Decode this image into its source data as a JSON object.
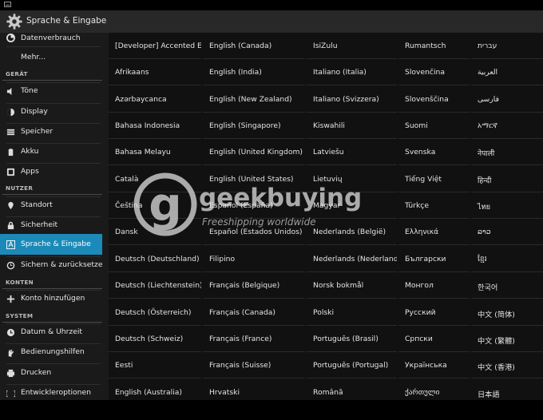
{
  "app": {
    "title": "Sprache & Eingabe"
  },
  "sidebar": {
    "items": [
      {
        "label": "Datenverbrauch",
        "icon": "data-usage-icon"
      },
      {
        "label": "Mehr...",
        "icon": ""
      },
      {
        "header": "GERÄT"
      },
      {
        "label": "Töne",
        "icon": "volume-icon"
      },
      {
        "label": "Display",
        "icon": "brightness-icon"
      },
      {
        "label": "Speicher",
        "icon": "storage-icon"
      },
      {
        "label": "Akku",
        "icon": "battery-icon"
      },
      {
        "label": "Apps",
        "icon": "apps-icon"
      },
      {
        "header": "NUTZER"
      },
      {
        "label": "Standort",
        "icon": "location-pin-icon"
      },
      {
        "label": "Sicherheit",
        "icon": "lock-icon"
      },
      {
        "label": "Sprache & Eingabe",
        "icon": "keyboard-a-icon",
        "selected": true
      },
      {
        "label": "Sichern & zurücksetzen",
        "icon": "backup-icon"
      },
      {
        "header": "KONTEN"
      },
      {
        "label": "Konto hinzufügen",
        "icon": "plus-icon"
      },
      {
        "header": "SYSTEM"
      },
      {
        "label": "Datum & Uhrzeit",
        "icon": "clock-icon"
      },
      {
        "label": "Bedienungshilfen",
        "icon": "hand-icon"
      },
      {
        "label": "Drucken",
        "icon": "printer-icon"
      },
      {
        "label": "Entwickleroptionen",
        "icon": "braces-icon"
      }
    ]
  },
  "languages": {
    "columns": [
      [
        "[Developer] Accented English",
        "Afrikaans",
        "Azərbaycanca",
        "Bahasa Indonesia",
        "Bahasa Melayu",
        "Català",
        "Čeština",
        "Dansk",
        "Deutsch (Deutschland)",
        "Deutsch (Liechtenstein)",
        "Deutsch (Österreich)",
        "Deutsch (Schweiz)",
        "Eesti",
        "English (Australia)"
      ],
      [
        "English (Canada)",
        "English (India)",
        "English (New Zealand)",
        "English (Singapore)",
        "English (United Kingdom)",
        "English (United States)",
        "Español (España)",
        "Español (Estados Unidos)",
        "Filipino",
        "Français (Belgique)",
        "Français (Canada)",
        "Français (France)",
        "Français (Suisse)",
        "Hrvatski"
      ],
      [
        "IsiZulu",
        "Italiano (Italia)",
        "Italiano (Svizzera)",
        "Kiswahili",
        "Latviešu",
        "Lietuvių",
        "Magyar",
        "Nederlands (België)",
        "Nederlands (Nederland)",
        "Norsk bokmål",
        "Polski",
        "Português (Brasil)",
        "Português (Portugal)",
        "Română"
      ],
      [
        "Rumantsch",
        "Slovenčina",
        "Slovenščina",
        "Suomi",
        "Svenska",
        "Tiếng Việt",
        "Türkçe",
        "Ελληνικά",
        "Български",
        "Монгол",
        "Русский",
        "Српски",
        "Українська",
        "ქართული"
      ],
      [
        "עברית",
        "العربية",
        "فارسی",
        "አማርኛ",
        "नेपाली",
        "हिन्दी",
        "ไทย",
        "ລາວ",
        "ខ្មែរ",
        "한국어",
        "中文 (简体)",
        "中文 (繁體)",
        "中文 (香港)",
        "日本語"
      ]
    ]
  },
  "watermark": {
    "brand": "geekbuying",
    "tagline": "Freeshipping worldwide"
  },
  "colors": {
    "accent": "#1b8ab8",
    "background": "#111111",
    "sidebar": "#1a1a1a",
    "actionbar": "#282828"
  }
}
